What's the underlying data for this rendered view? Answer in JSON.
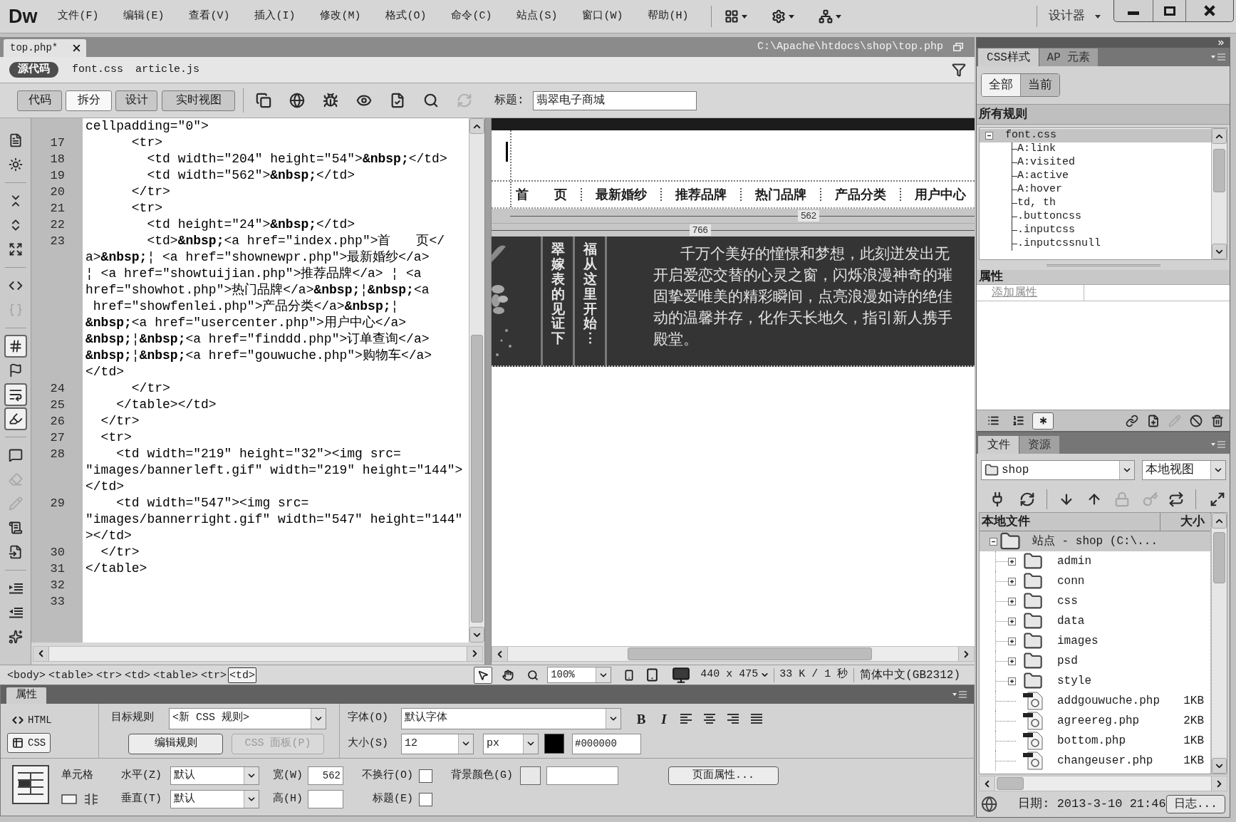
{
  "menubar": {
    "logo": "Dw",
    "menus": [
      "文件(F)",
      "编辑(E)",
      "查看(V)",
      "插入(I)",
      "修改(M)",
      "格式(O)",
      "命令(C)",
      "站点(S)",
      "窗口(W)",
      "帮助(H)"
    ],
    "workspace": "设计器"
  },
  "document": {
    "tab": "top.php*",
    "path": "C:\\Apache\\htdocs\\shop\\top.php"
  },
  "related_files": [
    {
      "label": "源代码",
      "selected": true
    },
    {
      "label": "font.css",
      "selected": false
    },
    {
      "label": "article.js",
      "selected": false
    }
  ],
  "document_toolbar": {
    "views": [
      {
        "label": "代码",
        "selected": false
      },
      {
        "label": "拆分",
        "selected": true
      },
      {
        "label": "设计",
        "selected": false
      },
      {
        "label": "实时视图",
        "selected": false
      }
    ],
    "tools": [
      {
        "kind": "files",
        "disabled": false
      },
      {
        "kind": "preview",
        "disabled": false
      },
      {
        "kind": "debug",
        "disabled": false
      },
      {
        "kind": "visual-aids",
        "disabled": false
      },
      {
        "kind": "validate",
        "disabled": false
      },
      {
        "kind": "check-page",
        "disabled": false
      },
      {
        "kind": "refresh",
        "disabled": true
      }
    ],
    "title_label": "标题:",
    "title": "翡翠电子商城"
  },
  "coding_toolbar": [
    {
      "kind": "open-documents",
      "on": false,
      "disabled": false
    },
    {
      "kind": "navigator",
      "on": false,
      "disabled": false
    },
    {
      "kind": "collapse-tag",
      "on": false,
      "disabled": false
    },
    {
      "kind": "collapse-selection",
      "on": false,
      "disabled": false
    },
    {
      "kind": "expand-all",
      "on": false,
      "disabled": false
    },
    {
      "kind": "select-parent",
      "on": false,
      "disabled": false
    },
    {
      "kind": "balance-braces",
      "on": false,
      "disabled": true
    },
    {
      "kind": "line-numbers",
      "on": true,
      "disabled": false
    },
    {
      "kind": "invalid-code",
      "on": false,
      "disabled": false
    },
    {
      "kind": "word-wrap",
      "on": true,
      "disabled": false
    },
    {
      "kind": "syntax-coloring",
      "on": true,
      "disabled": false
    },
    {
      "kind": "comment",
      "on": false,
      "disabled": false
    },
    {
      "kind": "uncomment",
      "on": false,
      "disabled": true
    },
    {
      "kind": "wrap-tag",
      "on": false,
      "disabled": true
    },
    {
      "kind": "snippets",
      "on": false,
      "disabled": false
    },
    {
      "kind": "move-css",
      "on": false,
      "disabled": false
    },
    {
      "kind": "indent",
      "on": false,
      "disabled": false
    },
    {
      "kind": "outdent",
      "on": false,
      "disabled": false
    },
    {
      "kind": "format",
      "on": false,
      "disabled": false
    }
  ],
  "code": {
    "rows": [
      {
        "text": "cellpadding=\"0\">"
      },
      {
        "number": "17",
        "text": "      <tr>"
      },
      {
        "number": "18",
        "text": "        <td width=\"204\" height=\"54\">**&nbsp;**</td>"
      },
      {
        "number": "19",
        "text": "        <td width=\"562\">**&nbsp;**</td>"
      },
      {
        "number": "20",
        "text": "      </tr>"
      },
      {
        "number": "21",
        "text": "      <tr>"
      },
      {
        "number": "22",
        "text": "        <td height=\"24\">**&nbsp;**</td>"
      },
      {
        "number": "23",
        "text": "        <td>**&nbsp;**<a href=\"index.php\">首　　页</"
      },
      {
        "text": "a>**&nbsp;**¦ <a href=\"shownewpr.php\">最新婚纱</a>"
      },
      {
        "text": "¦ <a href=\"showtuijian.php\">推荐品牌</a> ¦ <a"
      },
      {
        "text": "href=\"showhot.php\">热门品牌</a>**&nbsp;**¦**&nbsp;**<a"
      },
      {
        "text": " href=\"showfenlei.php\">产品分类</a>**&nbsp;**¦"
      },
      {
        "text": "**&nbsp;**<a href=\"usercenter.php\">用户中心</a>"
      },
      {
        "text": "**&nbsp;**¦**&nbsp;**<a href=\"finddd.php\">订单查询</a>"
      },
      {
        "text": "**&nbsp;**¦**&nbsp;**<a href=\"gouwuche.php\">购物车</a>"
      },
      {
        "text": "</td>"
      },
      {
        "number": "24",
        "text": "      </tr>"
      },
      {
        "number": "25",
        "text": "    </table></td>"
      },
      {
        "number": "26",
        "text": "  </tr>"
      },
      {
        "number": "27",
        "text": "  <tr>"
      },
      {
        "number": "28",
        "text": "    <td width=\"219\" height=\"32\"><img src="
      },
      {
        "text": "\"images/bannerleft.gif\" width=\"219\" height=\"144\">"
      },
      {
        "text": "</td>"
      },
      {
        "number": "29",
        "text": "    <td width=\"547\"><img src="
      },
      {
        "text": "\"images/bannerright.gif\" width=\"547\" height=\"144\""
      },
      {
        "text": "></td>"
      },
      {
        "number": "30",
        "text": "  </tr>"
      },
      {
        "number": "31",
        "text": "</table>"
      },
      {
        "number": "32"
      },
      {
        "number": "33"
      }
    ]
  },
  "design_view": {
    "nav_links": [
      "首　　页",
      "最新婚纱",
      "推荐品牌",
      "热门品牌",
      "产品分类",
      "用户中心"
    ],
    "width_labels": [
      "562",
      "766"
    ],
    "banner": {
      "columns": [
        "翠嫁表的见证下",
        "福从这里开始⋮"
      ],
      "paragraph": [
        "千万个美好的憧憬和梦想，此刻迸发出无",
        "开启爱恋交替的心灵之窗，闪烁浪漫神奇的璀",
        "固挚爱唯美的精彩瞬间，点亮浪漫如诗的绝佳",
        "动的温馨并存，化作天长地久，指引新人携手",
        "殿堂。"
      ]
    }
  },
  "tag_selector": [
    {
      "label": "<body>",
      "selected": false
    },
    {
      "label": "<table>",
      "selected": false
    },
    {
      "label": "<tr>",
      "selected": false
    },
    {
      "label": "<td>",
      "selected": false
    },
    {
      "label": "<table>",
      "selected": false
    },
    {
      "label": "<tr>",
      "selected": false
    },
    {
      "label": "<td>",
      "selected": true
    }
  ],
  "status_bar": {
    "tools": [
      {
        "kind": "pointer",
        "selected": true
      },
      {
        "kind": "hand",
        "selected": false
      },
      {
        "kind": "zoom",
        "selected": false
      }
    ],
    "zoom": "100%",
    "window_size": "440 x 475",
    "download": "33 K / 1 秒",
    "encoding": "简体中文(GB2312)"
  },
  "properties": {
    "title": "属性",
    "modes": [
      {
        "label": "HTML",
        "selected": false
      },
      {
        "label": "CSS",
        "selected": true
      }
    ],
    "target_rule": {
      "label": "目标规则",
      "value": "<新 CSS 规则>"
    },
    "rule_buttons": [
      {
        "label": "编辑规则",
        "disabled": false
      },
      {
        "label": "CSS 面板(P)",
        "disabled": true
      }
    ],
    "font": {
      "label": "字体(O)",
      "value": "默认字体"
    },
    "bold": "B",
    "italic": "I",
    "size": {
      "label": "大小(S)",
      "value": "12",
      "unit": "px"
    },
    "font_color": "#000000",
    "cell_label": "单元格",
    "horizontal": {
      "label": "水平(Z)",
      "value": "默认"
    },
    "vertical": {
      "label": "垂直(T)",
      "value": "默认"
    },
    "width": {
      "label": "宽(W)",
      "value": "562"
    },
    "height": {
      "label": "高(H)"
    },
    "no_wrap": {
      "label": "不换行(O)",
      "checked": false
    },
    "header": {
      "label": "标题(E)",
      "checked": false
    },
    "background": {
      "label": "背景颜色(G)"
    },
    "page_properties": "页面属性..."
  },
  "css_panel": {
    "tabs": [
      {
        "label": "CSS样式",
        "selected": true
      },
      {
        "label": "AP 元素",
        "selected": false
      }
    ],
    "modes": [
      {
        "label": "全部",
        "selected": true
      },
      {
        "label": "当前",
        "selected": false
      }
    ],
    "rules_header": "所有规则",
    "rules": [
      {
        "label": "font.css",
        "expanded": true,
        "selected": true,
        "children": [
          {
            "label": "A:link",
            "selected": false
          },
          {
            "label": "A:visited",
            "selected": false
          },
          {
            "label": "A:active",
            "selected": false
          },
          {
            "label": "A:hover",
            "selected": false
          },
          {
            "label": "td, th",
            "selected": false
          },
          {
            "label": ".buttoncss",
            "selected": false
          },
          {
            "label": ".inputcss",
            "selected": false
          },
          {
            "label": ".inputcssnull",
            "selected": false
          }
        ]
      }
    ],
    "properties_header": "属性",
    "add_property": "添加属性",
    "view_toggles": [
      {
        "kind": "category",
        "selected": false
      },
      {
        "kind": "alphabetical",
        "selected": false
      },
      {
        "kind": "set-only",
        "selected": true
      }
    ],
    "actions": [
      {
        "kind": "attach",
        "disabled": false
      },
      {
        "kind": "new",
        "disabled": false
      },
      {
        "kind": "edit",
        "disabled": true
      },
      {
        "kind": "disable",
        "disabled": false
      },
      {
        "kind": "delete",
        "disabled": false
      }
    ]
  },
  "files_panel": {
    "tabs": [
      {
        "label": "文件",
        "selected": true
      },
      {
        "label": "资源",
        "selected": false
      }
    ],
    "site": "shop",
    "view": "本地视图",
    "tools": [
      {
        "kind": "connect",
        "disabled": false
      },
      {
        "kind": "refresh",
        "disabled": false
      },
      {
        "kind": "get",
        "disabled": false
      },
      {
        "kind": "put",
        "disabled": false
      },
      {
        "kind": "check-out",
        "disabled": true
      },
      {
        "kind": "check-in",
        "disabled": true
      },
      {
        "kind": "sync",
        "disabled": false
      },
      {
        "kind": "expand",
        "disabled": false
      }
    ],
    "columns": [
      "本地文件",
      "大小"
    ],
    "tree": [
      {
        "label": "站点 - shop (C:\\...",
        "kind": "site",
        "expanded": true,
        "selected": true,
        "children": [
          {
            "label": "admin",
            "kind": "folder",
            "expanded": false,
            "selected": false
          },
          {
            "label": "conn",
            "kind": "folder",
            "expanded": false,
            "selected": false
          },
          {
            "label": "css",
            "kind": "folder",
            "expanded": false,
            "selected": false
          },
          {
            "label": "data",
            "kind": "folder",
            "expanded": false,
            "selected": false
          },
          {
            "label": "images",
            "kind": "folder",
            "expanded": false,
            "selected": false
          },
          {
            "label": "psd",
            "kind": "folder",
            "expanded": false,
            "selected": false
          },
          {
            "label": "style",
            "kind": "folder",
            "expanded": false,
            "selected": false
          },
          {
            "label": "addgouwuche.php",
            "kind": "file",
            "size": "1KB",
            "selected": false
          },
          {
            "label": "agreereg.php",
            "kind": "file",
            "size": "2KB",
            "selected": false
          },
          {
            "label": "bottom.php",
            "kind": "file",
            "size": "1KB",
            "selected": false
          },
          {
            "label": "changeuser.php",
            "kind": "file",
            "size": "1KB",
            "selected": false
          }
        ]
      }
    ],
    "date": "日期: 2013-3-10 21:46",
    "log_button": "日志..."
  }
}
